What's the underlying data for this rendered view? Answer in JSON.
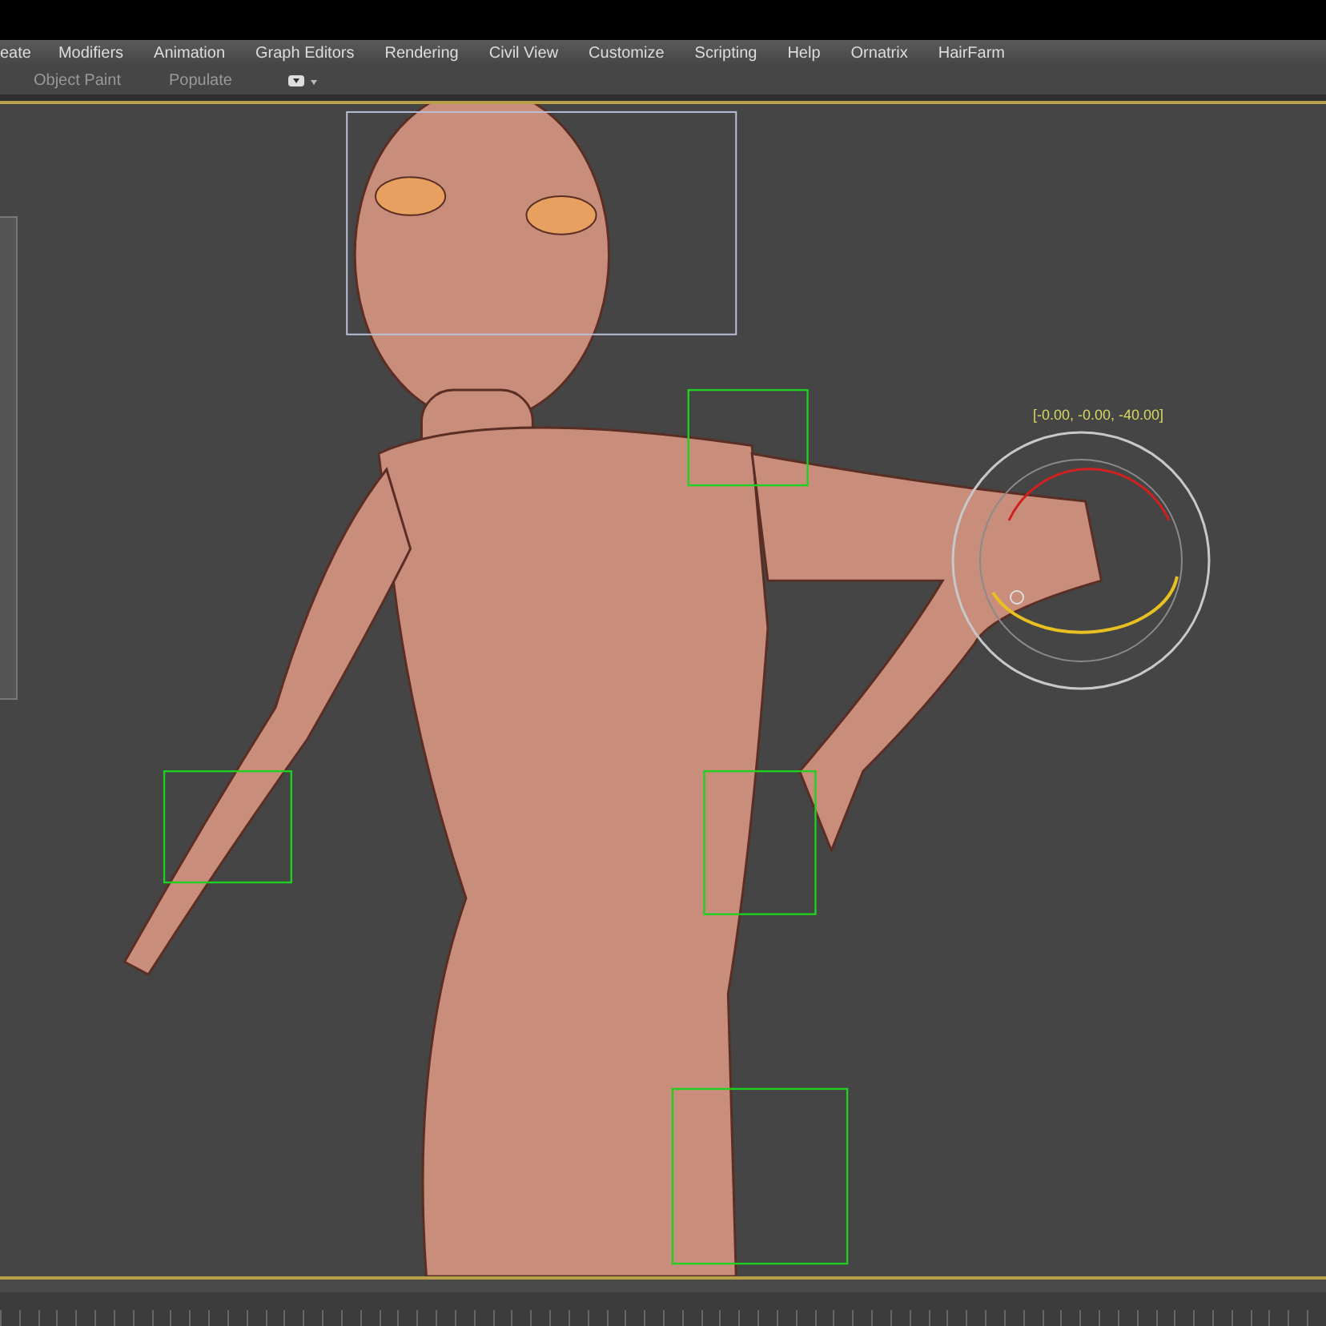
{
  "menu_bar": {
    "items": [
      "eate",
      "Modifiers",
      "Animation",
      "Graph Editors",
      "Rendering",
      "Civil View",
      "Customize",
      "Scripting",
      "Help",
      "Ornatrix",
      "HairFarm"
    ]
  },
  "ribbon": {
    "tabs": [
      "Object Paint",
      "Populate"
    ]
  },
  "viewport": {
    "gizmo_readout": "[-0.00, -0.00, -40.00]"
  }
}
